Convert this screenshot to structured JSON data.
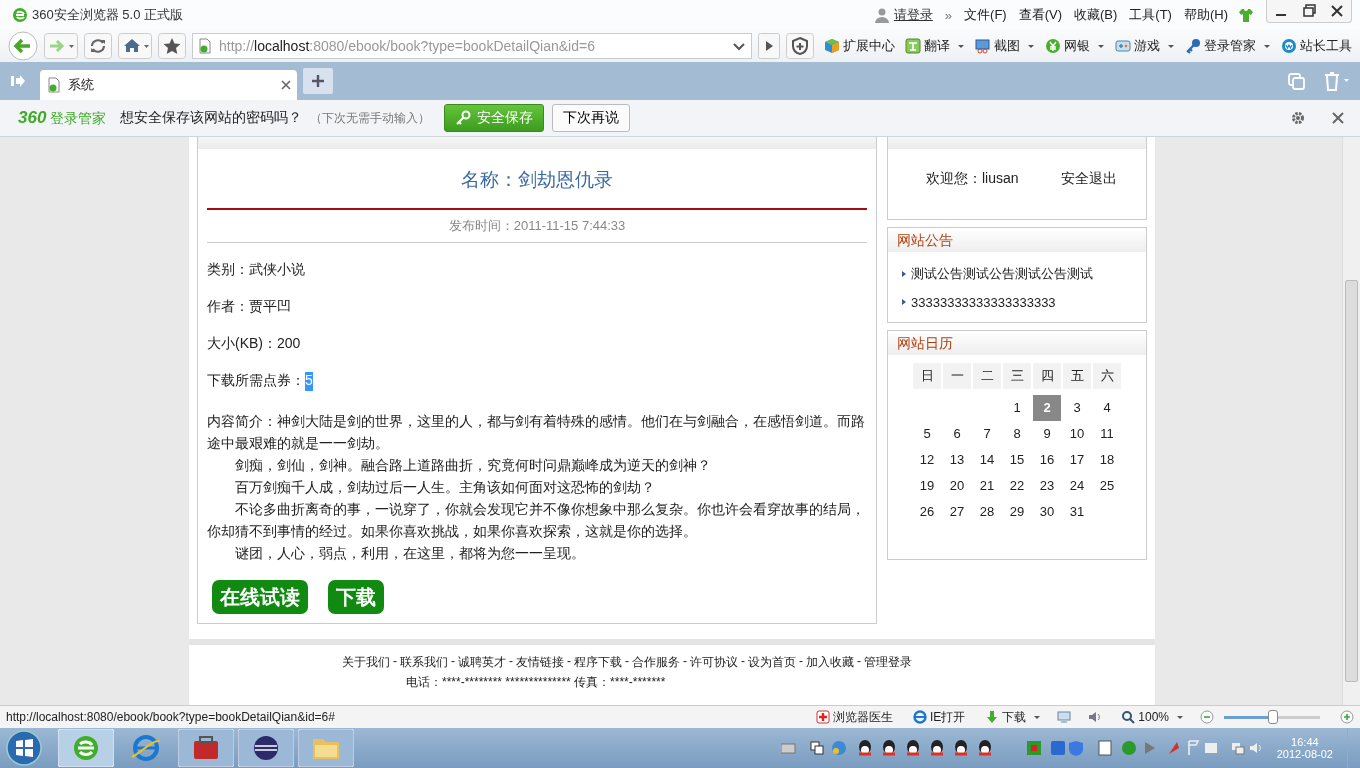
{
  "window": {
    "title": "360安全浏览器 5.0 正式版"
  },
  "account": {
    "login": "请登录",
    "more": "»"
  },
  "menu": [
    "文件(F)",
    "查看(V)",
    "收藏(B)",
    "工具(T)",
    "帮助(H)"
  ],
  "address": {
    "value_dim1": "http://",
    "value_host": "localhost",
    "value_dim2": ":8080/ebook/book?type=bookDetailQian&id=6"
  },
  "toolbar": [
    {
      "kind": "cube",
      "label": "扩展中心",
      "dropdown": false
    },
    {
      "kind": "translate",
      "label": "翻译",
      "dropdown": true
    },
    {
      "kind": "screenshot",
      "label": "截图",
      "dropdown": true
    },
    {
      "kind": "bank",
      "label": "网银",
      "dropdown": true
    },
    {
      "kind": "game",
      "label": "游戏",
      "dropdown": true
    },
    {
      "kind": "key",
      "label": "登录管家",
      "dropdown": true
    },
    {
      "kind": "webmaster",
      "label": "站长工具",
      "dropdown": false
    }
  ],
  "tabs": [
    {
      "label": "系统",
      "selected": true
    }
  ],
  "password_bar": {
    "brand_num": "360",
    "brand": "登录管家",
    "question": "想安全保存该网站的密码吗？",
    "hint": "（下次无需手动输入）",
    "save": "安全保存",
    "later": "下次再说"
  },
  "book": {
    "title": "名称：剑劫恩仇录",
    "published": "发布时间：2011-11-15 7:44:33",
    "fields": [
      "类别：武侠小说",
      "作者：贾平凹",
      "大小(KB)：200"
    ],
    "points": {
      "label": "下载所需点券：",
      "value": "5",
      "highlighted": true
    },
    "description": [
      {
        "text": "内容简介：神剑大陆是剑的世界，这里的人，都与剑有着特殊的感情。他们在与剑融合，在感悟剑道。而路途中最艰难的就是一一剑劫。",
        "indent": false
      },
      {
        "text": "剑痴，剑仙，剑神。融合路上道路曲折，究竟何时问鼎巅峰成为逆天的剑神？",
        "indent": true
      },
      {
        "text": "百万剑痴千人成，剑劫过后一人生。主角该如何面对这恐怖的剑劫？",
        "indent": true
      },
      {
        "text": "不论多曲折离奇的事，一说穿了，你就会发现它并不像你想象中那么复杂。你也许会看穿故事的结局，你却猜不到事情的经过。如果你喜欢挑战，如果你喜欢探索，这就是你的选择。",
        "indent": true
      },
      {
        "text": "谜团，人心，弱点，利用，在这里，都将为您一一呈现。",
        "indent": true
      }
    ],
    "buttons": [
      "在线试读",
      "下载"
    ]
  },
  "user": {
    "welcome": "欢迎您：liusan",
    "logout": "安全退出"
  },
  "notices": {
    "title": "网站公告",
    "items": [
      "测试公告测试公告测试公告测试",
      "33333333333333333333"
    ]
  },
  "calendar": {
    "title": "网站日历",
    "weekdays": [
      "日",
      "一",
      "二",
      "三",
      "四",
      "五",
      "六"
    ],
    "weeks": [
      [
        {
          "d": "1",
          "selected": false
        },
        {
          "d": "2",
          "selected": true
        },
        {
          "d": "3",
          "selected": false
        },
        {
          "d": "4",
          "selected": false
        }
      ],
      [
        {
          "d": "5",
          "selected": false
        },
        {
          "d": "6",
          "selected": false
        },
        {
          "d": "7",
          "selected": false
        },
        {
          "d": "8",
          "selected": false
        },
        {
          "d": "9",
          "selected": false
        },
        {
          "d": "10",
          "selected": false
        },
        {
          "d": "11",
          "selected": false
        }
      ],
      [
        {
          "d": "12",
          "selected": false
        },
        {
          "d": "13",
          "selected": false
        },
        {
          "d": "14",
          "selected": false
        },
        {
          "d": "15",
          "selected": false
        },
        {
          "d": "16",
          "selected": false
        },
        {
          "d": "17",
          "selected": false
        },
        {
          "d": "18",
          "selected": false
        }
      ],
      [
        {
          "d": "19",
          "selected": false
        },
        {
          "d": "20",
          "selected": false
        },
        {
          "d": "21",
          "selected": false
        },
        {
          "d": "22",
          "selected": false
        },
        {
          "d": "23",
          "selected": false
        },
        {
          "d": "24",
          "selected": false
        },
        {
          "d": "25",
          "selected": false
        }
      ],
      [
        {
          "d": "26",
          "selected": false
        },
        {
          "d": "27",
          "selected": false
        },
        {
          "d": "28",
          "selected": false
        },
        {
          "d": "29",
          "selected": false
        },
        {
          "d": "30",
          "selected": false
        },
        {
          "d": "31",
          "selected": false
        }
      ]
    ]
  },
  "footer": {
    "links": [
      "关于我们",
      "联系我们",
      "诚聘英才",
      "友情链接",
      "程序下载",
      "合作服务",
      "许可协议",
      "设为首页",
      "加入收藏",
      "管理登录"
    ],
    "separator": "-",
    "contact": "电话：****-******** ************** 传真：****-*******"
  },
  "status_bar": {
    "url": "http://localhost:8080/ebook/book?type=bookDetailQian&id=6#",
    "doctor": "浏览器医生",
    "ie": "IE打开",
    "download": "下载",
    "zoom": "100%",
    "zoom_level": {
      "level": 0.5
    }
  },
  "clock": {
    "time": "16:44",
    "date": "2012-08-02"
  }
}
